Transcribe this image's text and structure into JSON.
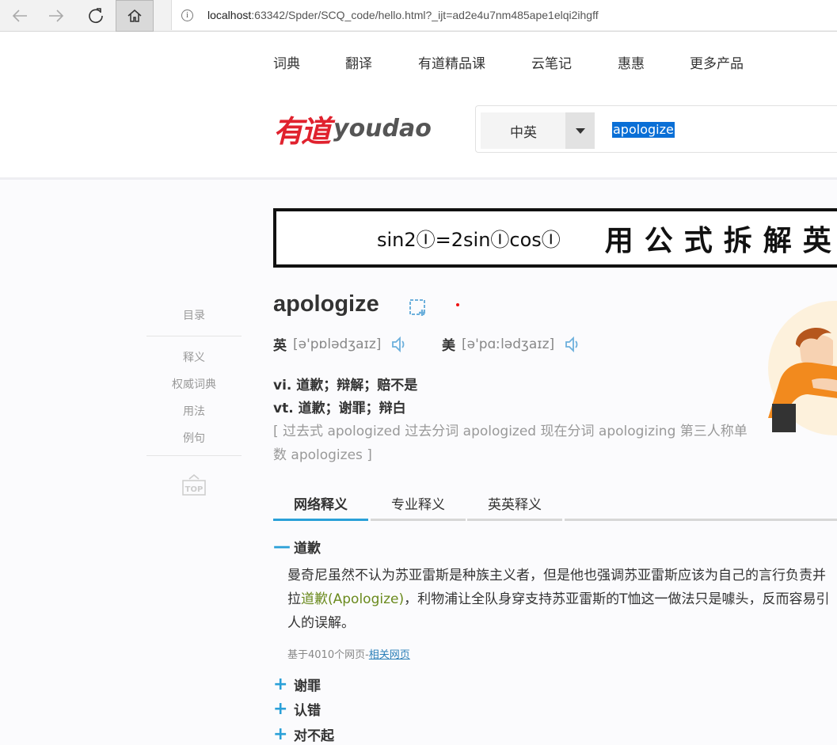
{
  "browser": {
    "url_host": "localhost",
    "url_rest": ":63342/Spder/SCQ_code/hello.html?_ijt=ad2e4u7nm485ape1elqi2ihgff",
    "info_glyph": "i"
  },
  "topnav": [
    "词典",
    "翻译",
    "有道精品课",
    "云笔记",
    "惠惠",
    "更多产品"
  ],
  "logo": {
    "cn": "有道",
    "en": "youdao"
  },
  "search": {
    "lang": "中英",
    "query": "apologize"
  },
  "banner": {
    "formula": "sin2Ⓘ=2sinⒾcosⒾ",
    "title": "用公式拆解英"
  },
  "sidemenu": {
    "head": "目录",
    "items": [
      "释义",
      "权威词典",
      "用法",
      "例句"
    ],
    "top_label": "TOP"
  },
  "word": {
    "headword": "apologize",
    "uk_label": "英",
    "uk_ipa": "[ə'pɒlədʒaɪz]",
    "us_label": "美",
    "us_ipa": "[ə'pɑːlədʒaɪz]",
    "trans": [
      "vi. 道歉；辩解；赔不是",
      "vt. 道歉；谢罪；辩白"
    ],
    "forms": "[ 过去式 apologized 过去分词 apologized 现在分词 apologizing 第三人称单数 apologizes ]"
  },
  "tabs": [
    "网络释义",
    "专业释义",
    "英英释义"
  ],
  "senses": [
    {
      "sign": "—",
      "label": "道歉"
    },
    {
      "sign": "+",
      "label": "谢罪"
    },
    {
      "sign": "+",
      "label": "认错"
    },
    {
      "sign": "+",
      "label": "对不起"
    }
  ],
  "example": {
    "line1": "曼奇尼虽然不认为苏亚雷斯是种族主义者，但是他也强调苏亚雷斯应该为自己的言行负责并",
    "line2_pre": "拉",
    "line2_hl": "道歉(Apologize)",
    "line2_post": "，利物浦让全队身穿支持苏亚雷斯的T恤这一做法只是噱头，反而容易引",
    "line3": "人的误解。"
  },
  "source": {
    "text": "基于4010个网页-",
    "link": "相关网页"
  },
  "colors": {
    "accent": "#2aa0d8",
    "logo_red": "#e0222e",
    "highlight": "#6a8a1d",
    "selection": "#0a6fd6"
  }
}
